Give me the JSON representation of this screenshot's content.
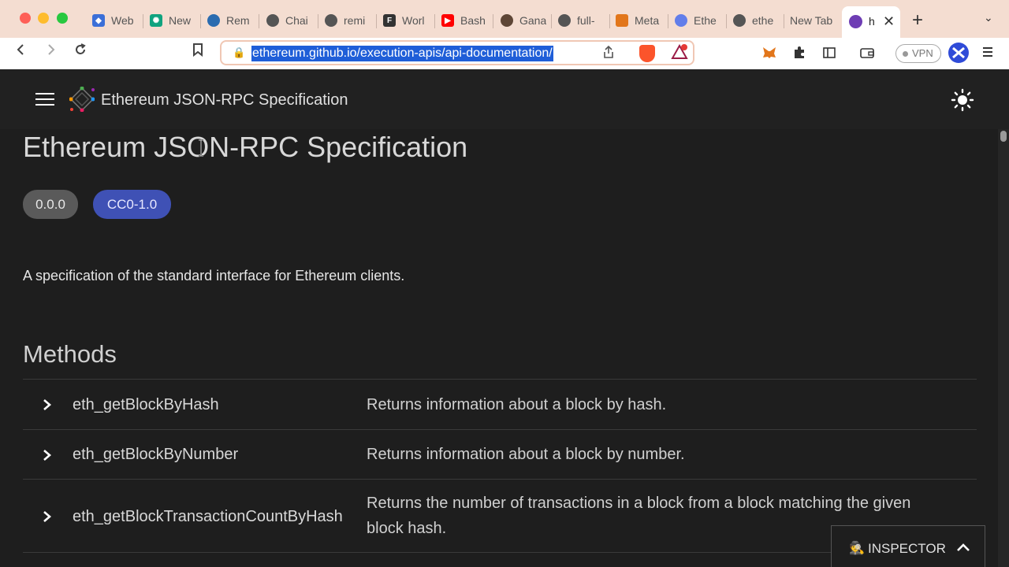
{
  "browser": {
    "tabs": [
      {
        "label": "Web",
        "icon": "web3-icon",
        "color": "#3b6fd8"
      },
      {
        "label": "New",
        "icon": "openai-icon",
        "color": "#10a37f"
      },
      {
        "label": "Rem",
        "icon": "remix-icon",
        "color": "#2b6cb0"
      },
      {
        "label": "Chai",
        "icon": "github-icon",
        "color": "#444444"
      },
      {
        "label": "remi",
        "icon": "github-icon",
        "color": "#444444"
      },
      {
        "label": "Worl",
        "icon": "fb-icon",
        "color": "#333333"
      },
      {
        "label": "Bash",
        "icon": "youtube-icon",
        "color": "#ff0000"
      },
      {
        "label": "Gana",
        "icon": "truffle-icon",
        "color": "#5e4636"
      },
      {
        "label": "full-",
        "icon": "github-icon",
        "color": "#444444"
      },
      {
        "label": "Meta",
        "icon": "metamask-icon",
        "color": "#e2761b"
      },
      {
        "label": "Ethe",
        "icon": "ethereum-icon",
        "color": "#627eea"
      },
      {
        "label": "ethe",
        "icon": "github-icon",
        "color": "#444444"
      },
      {
        "label": "New Tab",
        "icon": "",
        "color": "#333333"
      }
    ],
    "active_tab": {
      "label": "h",
      "close": "✕"
    },
    "new_tab_label": "+",
    "url": "ethereum.github.io/execution-apis/api-documentation/",
    "vpn_label": "VPN",
    "bat_badge": "1"
  },
  "header": {
    "title": "Ethereum JSON-RPC Specification"
  },
  "main": {
    "heading": "Ethereum JSON-RPC Specification",
    "version_chip": "0.0.0",
    "license_chip": "CC0-1.0",
    "description": "A specification of the standard interface for Ethereum clients.",
    "methods_heading": "Methods",
    "methods": [
      {
        "name": "eth_getBlockByHash",
        "description": "Returns information about a block by hash."
      },
      {
        "name": "eth_getBlockByNumber",
        "description": "Returns information about a block by number."
      },
      {
        "name": "eth_getBlockTransactionCountByHash",
        "description": "Returns the number of transactions in a block from a block matching the given block hash."
      }
    ]
  },
  "inspector": {
    "label": "INSPECTOR",
    "icon": "🕵"
  },
  "colors": {
    "background": "#1e1e1e",
    "license_chip": "#3f51b5",
    "version_chip": "#5a5a5a",
    "url_selection": "#1f5ed8"
  }
}
